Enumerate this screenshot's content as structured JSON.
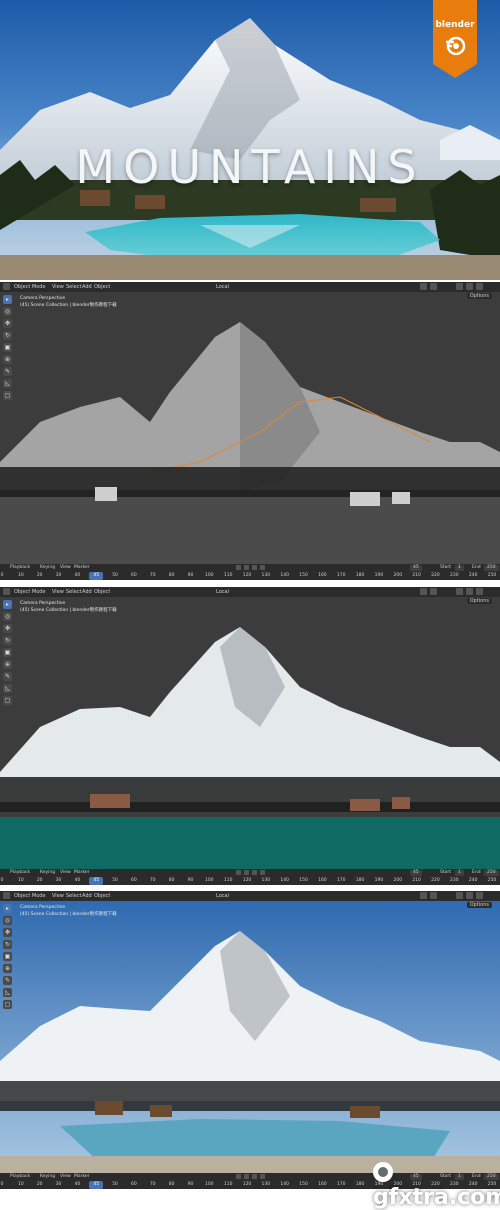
{
  "hero": {
    "title": "MOUNTAINS",
    "badge_label": "blender"
  },
  "viewport": {
    "header_items": [
      "Object Mode",
      "View",
      "Select",
      "Add",
      "Object"
    ],
    "transform_orientation": "Local",
    "options_label": "Options",
    "info_line1": "Camera Perspective",
    "info_line2": "(45) Scene Collection | blender制作教程下载"
  },
  "timeline": {
    "menu_items": [
      "Playback",
      "Keying",
      "View",
      "Marker"
    ],
    "current_frame": "45",
    "start_label": "Start",
    "start_value": "1",
    "end_label": "End",
    "end_value": "250",
    "ticks": [
      "0",
      "10",
      "20",
      "30",
      "40",
      "45",
      "50",
      "60",
      "70",
      "80",
      "90",
      "100",
      "110",
      "120",
      "130",
      "140",
      "150",
      "160",
      "170",
      "180",
      "190",
      "200",
      "210",
      "220",
      "230",
      "240",
      "250"
    ]
  },
  "watermark": {
    "text": "gfxtra.com"
  },
  "colors": {
    "blender_orange": "#e87d0d",
    "ui_dark": "#2b2b2b",
    "viewport_bg": "#3b3b3b",
    "active_blue": "#4772b3",
    "water_teal": "#0e6a62"
  }
}
